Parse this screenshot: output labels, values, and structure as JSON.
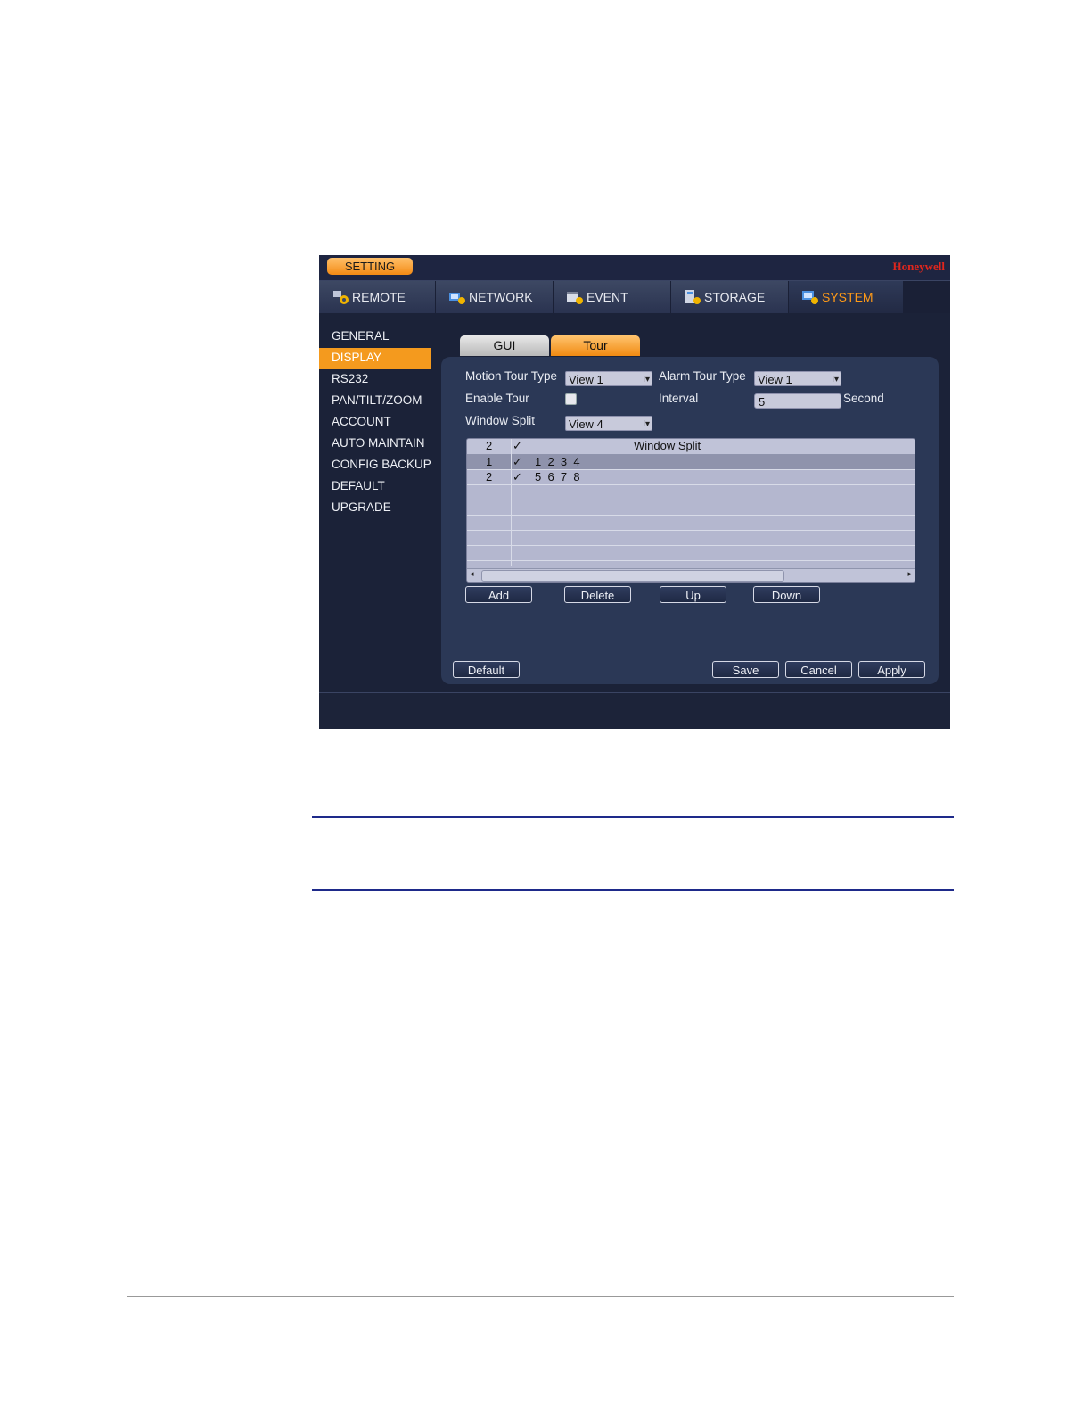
{
  "titlebar": {
    "setting_label": "SETTING",
    "brand": "Honeywell"
  },
  "main_tabs": [
    {
      "label": "REMOTE",
      "icon": "remote-gear-icon"
    },
    {
      "label": "NETWORK",
      "icon": "network-gear-icon"
    },
    {
      "label": "EVENT",
      "icon": "event-gear-icon"
    },
    {
      "label": "STORAGE",
      "icon": "storage-gear-icon"
    },
    {
      "label": "SYSTEM",
      "icon": "system-gear-icon",
      "active": true
    }
  ],
  "sidebar": {
    "items": [
      {
        "label": "GENERAL"
      },
      {
        "label": "DISPLAY",
        "active": true
      },
      {
        "label": "RS232"
      },
      {
        "label": "PAN/TILT/ZOOM"
      },
      {
        "label": "ACCOUNT"
      },
      {
        "label": "AUTO MAINTAIN"
      },
      {
        "label": "CONFIG BACKUP"
      },
      {
        "label": "DEFAULT"
      },
      {
        "label": "UPGRADE"
      }
    ]
  },
  "sub_tabs": {
    "gui": "GUI",
    "tour": "Tour"
  },
  "form": {
    "motion_tour_type_label": "Motion Tour Type",
    "motion_tour_type_value": "View 1",
    "alarm_tour_type_label": "Alarm Tour Type",
    "alarm_tour_type_value": "View 1",
    "enable_tour_label": "Enable Tour",
    "enable_tour_checked": false,
    "interval_label": "Interval",
    "interval_value": "5",
    "interval_unit": "Second",
    "window_split_label": "Window Split",
    "window_split_value": "View 4"
  },
  "table": {
    "header": {
      "count": "2",
      "check": "✓",
      "title": "Window Split"
    },
    "rows": [
      {
        "num": "1",
        "check": "✓",
        "channels": "1  2  3  4",
        "selected": true
      },
      {
        "num": "2",
        "check": "✓",
        "channels": "5  6  7  8",
        "selected": false
      }
    ]
  },
  "table_buttons": {
    "add": "Add",
    "delete": "Delete",
    "up": "Up",
    "down": "Down"
  },
  "footer_buttons": {
    "default": "Default",
    "save": "Save",
    "cancel": "Cancel",
    "apply": "Apply"
  },
  "colors": {
    "accent": "#f49a1e",
    "active_tab_text": "#ff9a17",
    "brand_red": "#e0261d",
    "rule_blue": "#1e2a8a"
  }
}
